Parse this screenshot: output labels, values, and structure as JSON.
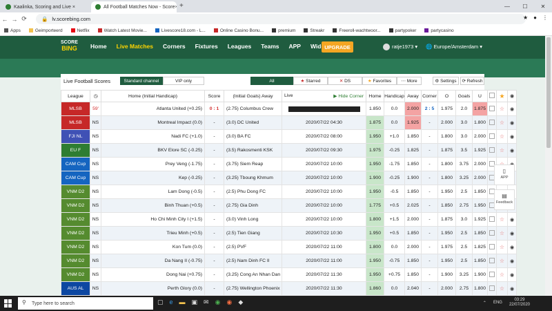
{
  "browser": {
    "tabs": [
      {
        "title": "Kaalinka, Scoring and Live ×"
      },
      {
        "title": "All Football Matches Now - Score"
      }
    ],
    "url": "lv.scorebing.com",
    "bookmarks": [
      "Apps",
      "Geimporteerd",
      "Netflix",
      "Watch Latest Movie...",
      "Livescore18.com - L...",
      "Online Casino Bonu...",
      "premium",
      "Streakr",
      "Freeroll-wachtwoor...",
      "partypoker",
      "partycasino"
    ]
  },
  "site": {
    "logo_top": "SCORE",
    "logo_bottom": "BING",
    "nav": [
      "Home",
      "Live Matches",
      "Corners",
      "Fixtures",
      "Leagues",
      "Teams",
      "APP",
      "Widgets"
    ],
    "upgrade": "UPGRADE",
    "user": "ratje1973 ▾",
    "timezone": "Europe/Amsterdam ▾"
  },
  "toolbar": {
    "title": "Live Football Scores",
    "standard": "Standard channel",
    "vip": "VIP only",
    "all": "All",
    "starred": "Starred",
    "ds": "DS",
    "favorites": "Favorites",
    "more": "More",
    "settings": "Settings",
    "refresh": "Refresh",
    "hide_corner": "Hide Corner"
  },
  "columns": [
    "League",
    "",
    "Home (Initial Handicap)",
    "Score",
    "(Initial Goals) Away",
    "Live",
    "Home",
    "Handicap",
    "Away",
    "Corner",
    "O",
    "Goals",
    "U",
    "",
    "",
    ""
  ],
  "rows": [
    {
      "league": "MLSB",
      "color": "#c62828",
      "time": "59'",
      "home": "Atlanta United (+0.25)",
      "score": "0 : 1",
      "away": "(2.75) Columbus Crew",
      "live": "",
      "h": "1.850",
      "hc": "0.0",
      "a": "2.000",
      "c": "2 : 5",
      "o": "1.975",
      "g": "2.0",
      "u": "1.875"
    },
    {
      "league": "MLSB",
      "color": "#c62828",
      "time": "NS",
      "home": "Montreal Impact (0.0)",
      "score": "-",
      "away": "(3.0) DC United",
      "live": "2020/07/22 04:30",
      "h": "1.875",
      "hc": "0.0",
      "a": "1.925",
      "c": "-",
      "o": "2.000",
      "g": "3.0",
      "u": "1.800"
    },
    {
      "league": "FJI NL",
      "color": "#3f51b5",
      "time": "NS",
      "home": "Nadi FC (+1.0)",
      "score": "-",
      "away": "(3.0) BA FC",
      "live": "2020/07/22 08:00",
      "h": "1.950",
      "hc": "+1.0",
      "a": "1.850",
      "c": "-",
      "o": "1.800",
      "g": "3.0",
      "u": "2.000"
    },
    {
      "league": "EU F",
      "color": "#2e7d32",
      "time": "NS",
      "home": "BKV Elore SC (-0.25)",
      "score": "-",
      "away": "(3.5) Rakosmenti KSK",
      "live": "2020/07/22 09:30",
      "h": "1.975",
      "hc": "-0.25",
      "a": "1.825",
      "c": "-",
      "o": "1.875",
      "g": "3.5",
      "u": "1.925"
    },
    {
      "league": "CAM Cup",
      "color": "#1565c0",
      "time": "NS",
      "home": "Prey Veng (-1.75)",
      "score": "-",
      "away": "(3.75) Siem Reap",
      "live": "2020/07/22 10:00",
      "h": "1.950",
      "hc": "-1.75",
      "a": "1.850",
      "c": "-",
      "o": "1.800",
      "g": "3.75",
      "u": "2.000"
    },
    {
      "league": "CAM Cup",
      "color": "#1565c0",
      "time": "NS",
      "home": "Kep (-0.25)",
      "score": "-",
      "away": "(3.25) Tboung Khmum",
      "live": "2020/07/22 10:00",
      "h": "1.900",
      "hc": "-0.25",
      "a": "1.900",
      "c": "-",
      "o": "1.800",
      "g": "3.25",
      "u": "2.000"
    },
    {
      "league": "VNM D2",
      "color": "#558b2f",
      "time": "NS",
      "home": "Lam Dong (-0.5)",
      "score": "-",
      "away": "(2.5) Phu Dong FC",
      "live": "2020/07/22 10:00",
      "h": "1.950",
      "hc": "-0.5",
      "a": "1.850",
      "c": "-",
      "o": "1.950",
      "g": "2.5",
      "u": "1.850"
    },
    {
      "league": "VNM D2",
      "color": "#558b2f",
      "time": "NS",
      "home": "Binh Thuan (+0.5)",
      "score": "-",
      "away": "(2.75) Gia Dinh",
      "live": "2020/07/22 10:00",
      "h": "1.775",
      "hc": "+0.5",
      "a": "2.025",
      "c": "-",
      "o": "1.850",
      "g": "2.75",
      "u": "1.950"
    },
    {
      "league": "VNM D2",
      "color": "#558b2f",
      "time": "NS",
      "home": "Ho Chi Minh City I (+1.5)",
      "score": "-",
      "away": "(3.0) Vinh Long",
      "live": "2020/07/22 10:00",
      "h": "1.800",
      "hc": "+1.5",
      "a": "2.000",
      "c": "-",
      "o": "1.875",
      "g": "3.0",
      "u": "1.925"
    },
    {
      "league": "VNM D2",
      "color": "#558b2f",
      "time": "NS",
      "home": "Trieu Minh (+0.5)",
      "score": "-",
      "away": "(2.5) Tien Giang",
      "live": "2020/07/22 10:30",
      "h": "1.950",
      "hc": "+0.5",
      "a": "1.850",
      "c": "-",
      "o": "1.950",
      "g": "2.5",
      "u": "1.850"
    },
    {
      "league": "VNM D2",
      "color": "#558b2f",
      "time": "NS",
      "home": "Kon Tum (0.0)",
      "score": "-",
      "away": "(2.5) PVF",
      "live": "2020/07/22 11:00",
      "h": "1.800",
      "hc": "0.0",
      "a": "2.000",
      "c": "-",
      "o": "1.975",
      "g": "2.5",
      "u": "1.825"
    },
    {
      "league": "VNM D2",
      "color": "#558b2f",
      "time": "NS",
      "home": "Da Nang II (-0.75)",
      "score": "-",
      "away": "(2.5) Nam Dinh FC II",
      "live": "2020/07/22 11:00",
      "h": "1.950",
      "hc": "-0.75",
      "a": "1.850",
      "c": "-",
      "o": "1.950",
      "g": "2.5",
      "u": "1.850"
    },
    {
      "league": "VNM D2",
      "color": "#558b2f",
      "time": "NS",
      "home": "Dong Nai (+0.75)",
      "score": "-",
      "away": "(3.25) Cong An Nhan Dan",
      "live": "2020/07/22 11:30",
      "h": "1.950",
      "hc": "+0.75",
      "a": "1.850",
      "c": "-",
      "o": "1.900",
      "g": "3.25",
      "u": "1.900"
    },
    {
      "league": "AUS AL",
      "color": "#0d47a1",
      "time": "NS",
      "home": "Perth Glory (0.0)",
      "score": "-",
      "away": "(2.75) Wellington Phoenix",
      "live": "2020/07/22 11:30",
      "h": "1.860",
      "hc": "0.0",
      "a": "2.040",
      "c": "-",
      "o": "2.000",
      "g": "2.75",
      "u": "1.800"
    }
  ],
  "side_buttons": [
    {
      "label": "APP"
    },
    {
      "label": "Feedback"
    }
  ],
  "taskbar": {
    "search": "Type here to search",
    "lang": "ENG",
    "time": "03:29",
    "date": "22/07/2020"
  }
}
